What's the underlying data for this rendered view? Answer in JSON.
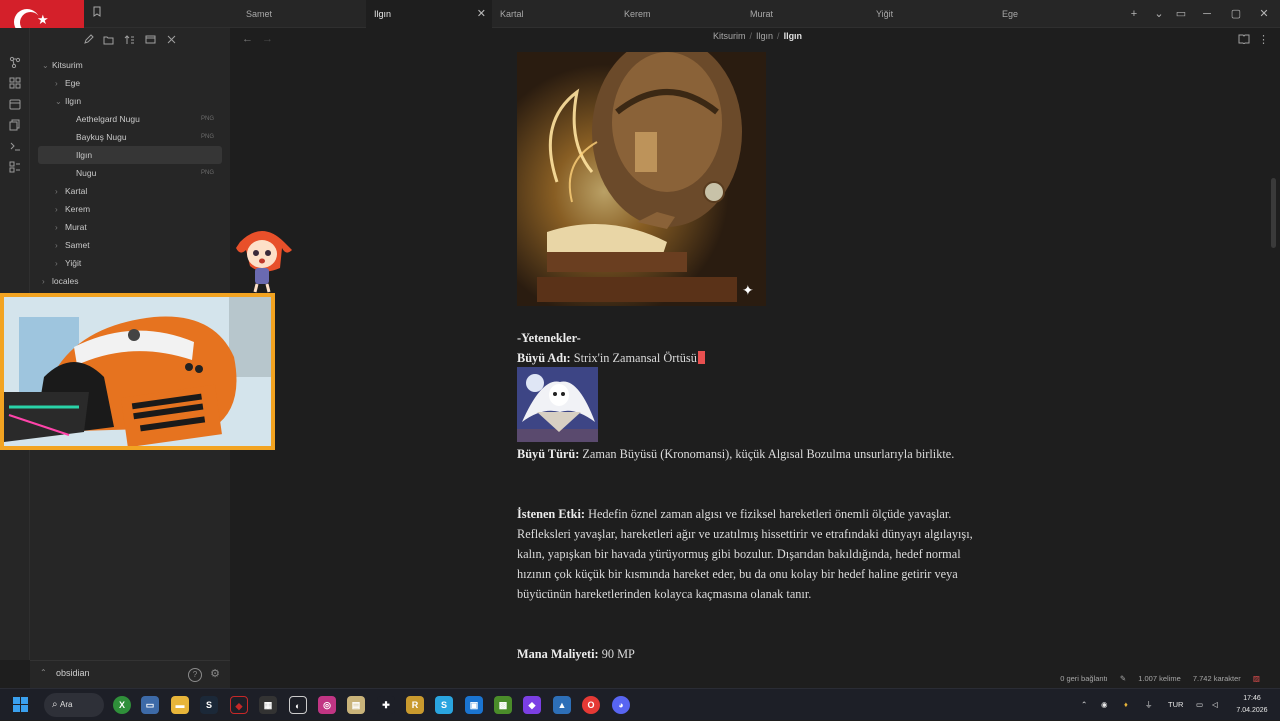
{
  "tabs": [
    {
      "label": "Samet",
      "active": false
    },
    {
      "label": "Ilgın",
      "active": true
    },
    {
      "label": "Kartal",
      "active": false
    },
    {
      "label": "Kerem",
      "active": false
    },
    {
      "label": "Murat",
      "active": false
    },
    {
      "label": "Yiğit",
      "active": false
    },
    {
      "label": "Ege",
      "active": false
    }
  ],
  "tab_close": "✕",
  "window_controls": {
    "new_tab": "+",
    "dropdown": "⌄",
    "sidebar": "▭",
    "minimize": "─",
    "maximize": "▢",
    "close": "✕"
  },
  "breadcrumb": {
    "root": "Kitsurim",
    "parent": "Ilgın",
    "current": "Ilgın"
  },
  "file_tree": [
    {
      "label": "Kitsurim",
      "chev": "⌄"
    },
    {
      "label": "Ege",
      "chev": "›"
    },
    {
      "label": "Ilgın",
      "chev": "⌄"
    },
    {
      "label": "Aethelgard Nugu",
      "tag": "PNG"
    },
    {
      "label": "Baykuş Nugu",
      "tag": "PNG"
    },
    {
      "label": "Ilgın"
    },
    {
      "label": "Nugu",
      "tag": "PNG"
    },
    {
      "label": "Kartal",
      "chev": "›"
    },
    {
      "label": "Kerem",
      "chev": "›"
    },
    {
      "label": "Murat",
      "chev": "›"
    },
    {
      "label": "Samet",
      "chev": "›"
    },
    {
      "label": "Yiğit",
      "chev": "›"
    },
    {
      "label": "locales",
      "chev": "›"
    }
  ],
  "vault": {
    "name": "obsidian",
    "chev": "⌃",
    "help": "?",
    "settings": "⚙"
  },
  "document": {
    "section_heading": "-Yetenekler-",
    "spell_name_label": "Büyü Adı:",
    "spell_name_value": "Strix'in Zamansal Örtüsü",
    "spell_type_label": "Büyü Türü:",
    "spell_type_value": "Zaman Büyüsü (Kronomansi), küçük Algısal Bozulma unsurlarıyla birlikte.",
    "effect_label": "İstenen Etki:",
    "effect_value": "Hedefin öznel zaman algısı ve fiziksel hareketleri önemli ölçüde yavaşlar. Refleksleri yavaşlar, hareketleri ağır ve uzatılmış hissettirir ve etrafındaki dünyayı algılayışı, kalın, yapışkan bir havada yürüyormuş gibi bozulur. Dışarıdan bakıldığında, hedef normal hızının çok küçük bir kısmında hareket eder, bu da onu kolay bir hedef haline getirir veya büyücünün hareketlerinden kolayca kaçmasına olanak tanır.",
    "mana_label": "Mana Maliyeti:",
    "mana_value": "90 MP"
  },
  "status_bar": {
    "backlinks": "0 geri bağlantı",
    "words": "1.007 kelime",
    "chars": "7.742 karakter"
  },
  "taskbar": {
    "search_label": "Ara",
    "language": "TUR",
    "time": "17:46",
    "date": "7.04.2026"
  },
  "colors": {
    "accent": "#e85050",
    "flag_red": "#d4202a",
    "cam_border": "#f2a321"
  }
}
